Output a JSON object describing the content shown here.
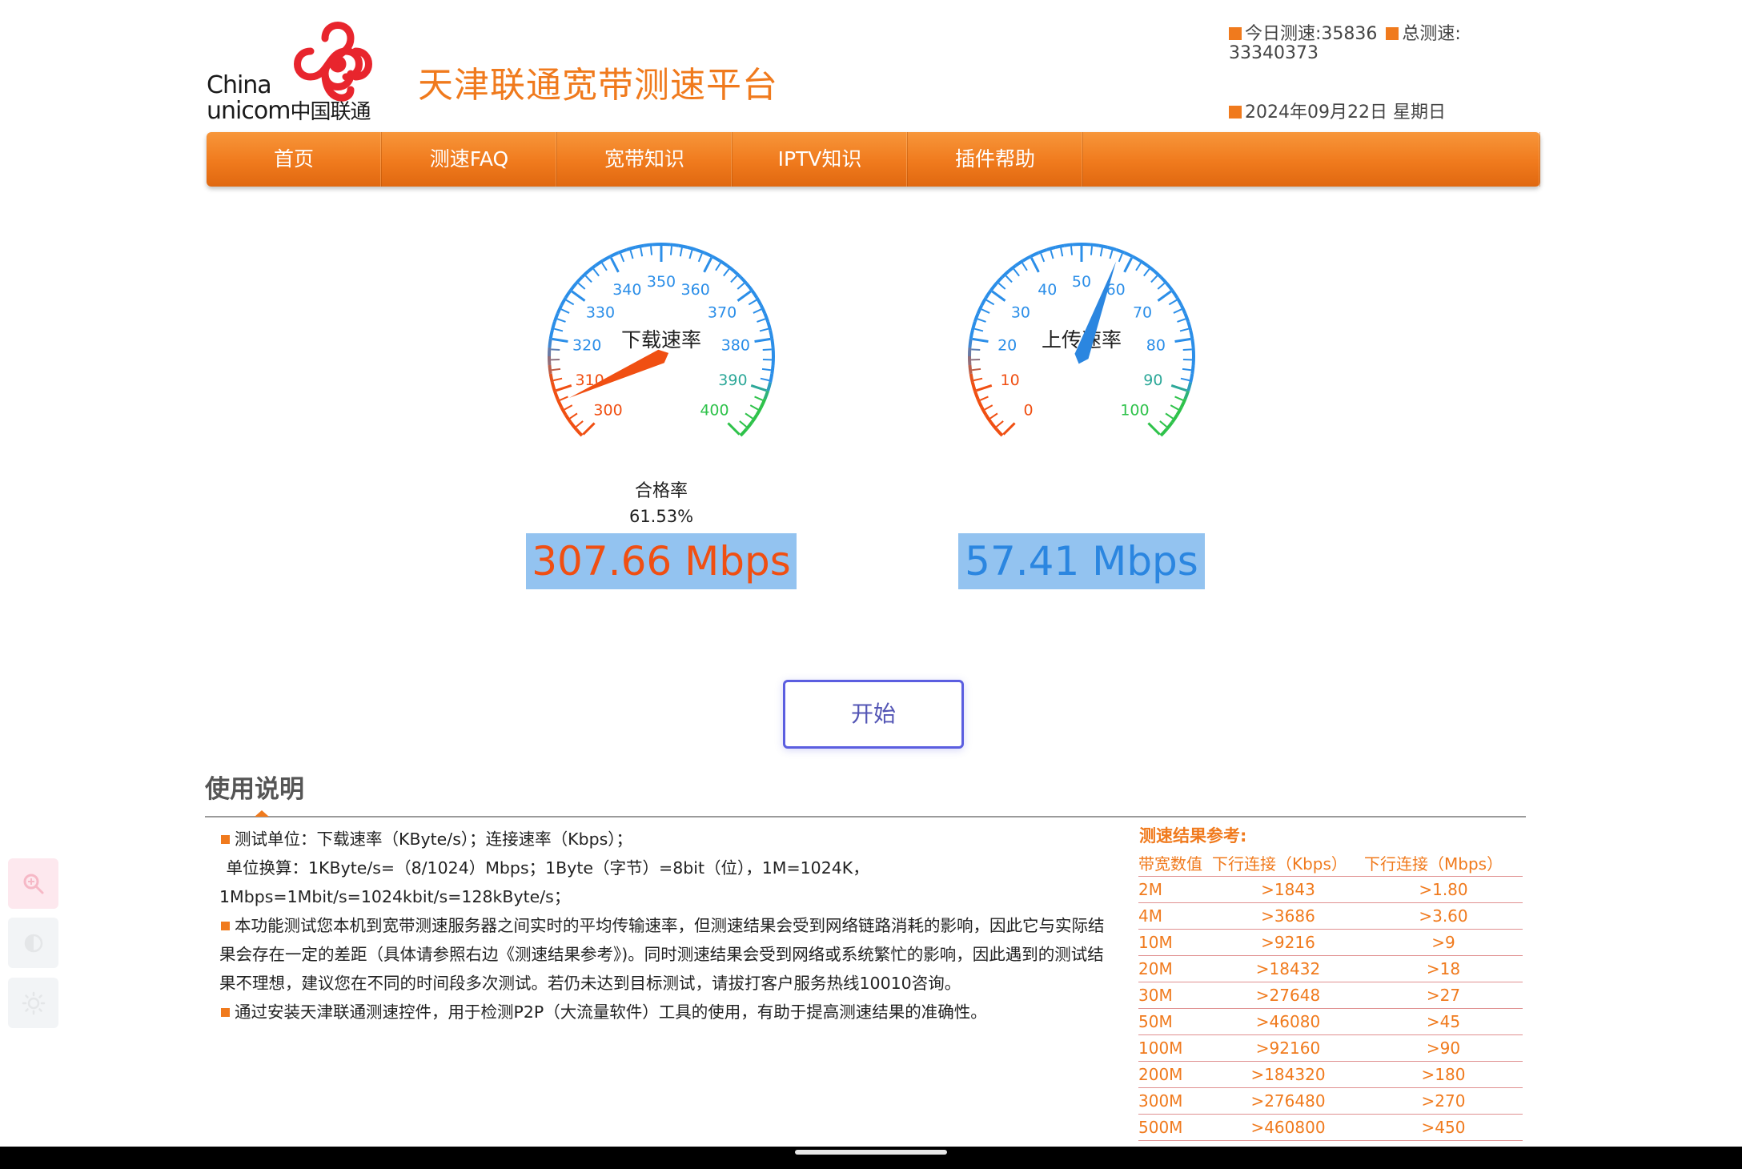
{
  "header": {
    "logo_en_line1": "China",
    "logo_en_line2": "unicom",
    "logo_cn": "中国联通",
    "site_title": "天津联通宽带测速平台",
    "today_label": "今日测速:",
    "today_value": "35836",
    "total_label": "总测速:",
    "total_value": "33340373",
    "date": "2024年09月22日 星期日",
    "brand_color": "#f07a1d",
    "logo_color": "#e8252d"
  },
  "nav": {
    "items": [
      {
        "label": "首页"
      },
      {
        "label": "测速FAQ"
      },
      {
        "label": "宽带知识"
      },
      {
        "label": "IPTV知识"
      },
      {
        "label": "插件帮助"
      }
    ]
  },
  "download_gauge": {
    "title": "下载速率",
    "min": 300,
    "max": 400,
    "ticks": [
      "300",
      "310",
      "320",
      "330",
      "340",
      "350",
      "360",
      "370",
      "380",
      "390",
      "400"
    ],
    "value": 307.66,
    "pass_label": "合格率",
    "pass_value": "61.53%",
    "readout": "307.66 Mbps",
    "needle_color": "#f04f12"
  },
  "upload_gauge": {
    "title": "上传速率",
    "min": 0,
    "max": 100,
    "ticks": [
      "0",
      "10",
      "20",
      "30",
      "40",
      "50",
      "60",
      "70",
      "80",
      "90",
      "100"
    ],
    "value": 57.41,
    "readout": "57.41 Mbps",
    "needle_color": "#2b86e0"
  },
  "start_button": {
    "label": "开始"
  },
  "instructions": {
    "title": "使用说明",
    "lines": [
      "测试单位：下载速率（KByte/s）；连接速率（Kbps）；",
      " 单位换算：1KByte/s=（8/1024）Mbps；1Byte（字节）=8bit（位），1M=1024K，",
      "1Mbps=1Mbit/s=1024kbit/s=128kByte/s；",
      "本功能测试您本机到宽带测速服务器之间实时的平均传输速率，但测速结果会受到网络链路消耗的影响，因此它与实际结",
      "果会存在一定的差距（具体请参照右边《测速结果参考》)。同时测速结果会受到网络或系统繁忙的影响，因此遇到的测试结",
      "果不理想，建议您在不同的时间段多次测试。若仍未达到目标测试，请拔打客户服务热线10010咨询。",
      "通过安装天津联通测速控件，用于检测P2P（大流量软件）工具的使用，有助于提高测速结果的准确性。"
    ]
  },
  "reference": {
    "title": "测速结果参考:",
    "headers": [
      "带宽数值",
      "下行连接（Kbps）",
      "下行连接（Mbps）"
    ],
    "rows": [
      [
        "2M",
        ">1843",
        ">1.80"
      ],
      [
        "4M",
        ">3686",
        ">3.60"
      ],
      [
        "10M",
        ">9216",
        ">9"
      ],
      [
        "20M",
        ">18432",
        ">18"
      ],
      [
        "30M",
        ">27648",
        ">27"
      ],
      [
        "50M",
        ">46080",
        ">45"
      ],
      [
        "100M",
        ">92160",
        ">90"
      ],
      [
        "200M",
        ">184320",
        ">180"
      ],
      [
        "300M",
        ">276480",
        ">270"
      ],
      [
        "500M",
        ">460800",
        ">450"
      ]
    ]
  },
  "side_tools": [
    {
      "icon": "zoom-icon"
    },
    {
      "icon": "contrast-icon"
    },
    {
      "icon": "brightness-icon"
    }
  ]
}
